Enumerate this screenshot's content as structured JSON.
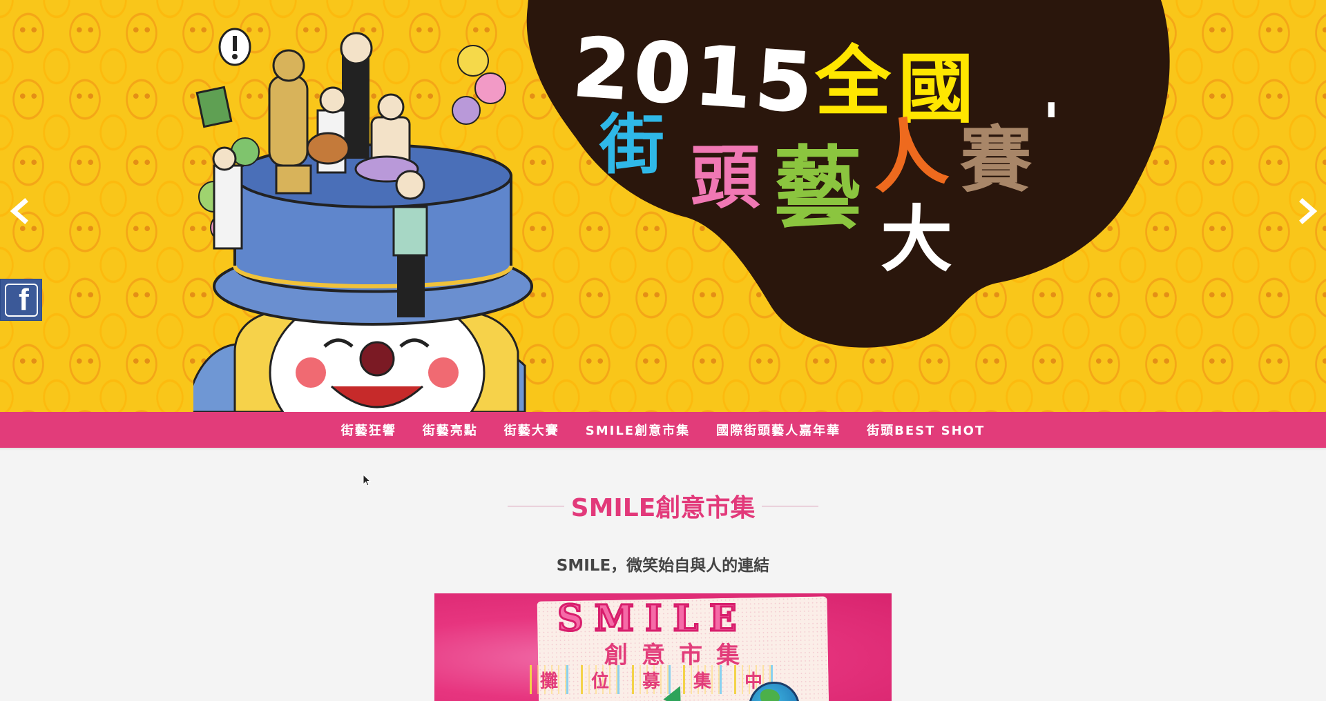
{
  "hero": {
    "year": "2015",
    "title_chars": [
      "全",
      "國",
      "街",
      "頭",
      "藝",
      "人",
      "賽",
      "大",
      "'"
    ],
    "colors": {
      "background": "#f9c61a",
      "blob": "#2a160c",
      "yellow": "#ffe600",
      "blue": "#2fb8e8",
      "pink": "#f078b4",
      "green": "#8bc53f",
      "orange": "#ee6a1e",
      "brown": "#a88668"
    }
  },
  "carousel": {
    "prev_icon": "chevron-left-icon",
    "next_icon": "chevron-right-icon"
  },
  "social": {
    "facebook_glyph": "f",
    "icon": "facebook-icon"
  },
  "nav": {
    "items": [
      {
        "label": "街藝狂響"
      },
      {
        "label": "街藝亮點"
      },
      {
        "label": "街藝大賽"
      },
      {
        "label": "SMILE創意市集"
      },
      {
        "label": "國際街頭藝人嘉年華"
      },
      {
        "label": "街頭BEST SHOT"
      }
    ],
    "color": "#e23c7a"
  },
  "content": {
    "section_title": "SMILE創意市集",
    "subtitle": "SMILE，微笑始自與人的連結",
    "poster": {
      "heading": "SMILE",
      "sub": "創意市集",
      "row": [
        "攤",
        "位",
        "募",
        "集",
        "中"
      ]
    },
    "accent": "#e2397a"
  }
}
